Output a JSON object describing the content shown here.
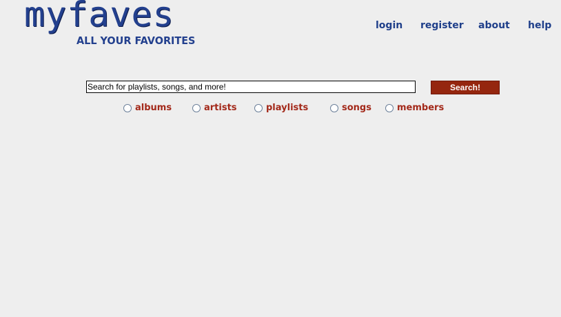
{
  "logo": {
    "name": "myfaves",
    "tagline": "ALL YOUR FAVORITES"
  },
  "nav": {
    "login": "login",
    "register": "register",
    "about": "about",
    "help": "help"
  },
  "search": {
    "value": "Search for playlists, songs, and more!",
    "button_label": "Search!"
  },
  "scopes": [
    {
      "label": "albums",
      "selected": false
    },
    {
      "label": "artists",
      "selected": false
    },
    {
      "label": "playlists",
      "selected": false
    },
    {
      "label": "songs",
      "selected": false
    },
    {
      "label": "members",
      "selected": false
    }
  ],
  "colors": {
    "background": "#eeeeee",
    "brand_blue": "#23408e",
    "nav_blue": "#1f3f8a",
    "accent_red": "#a3291a",
    "button_red": "#95260f"
  }
}
